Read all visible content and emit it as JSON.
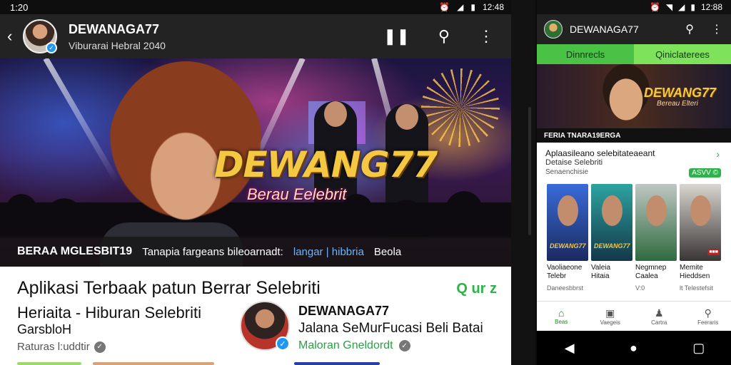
{
  "left": {
    "status": {
      "time": "1:20",
      "clock": "12:48"
    },
    "appbar": {
      "back": "‹",
      "channel_name": "DEWANAGA77",
      "channel_sub": "Viburarai Hebral 2040"
    },
    "banner": {
      "brand": "DEWANG77",
      "brand_sub": "Berau Eelebrit",
      "caption_bold": "BERAA MGLESBIT19",
      "caption_text": "Tanapia fargeans bileoarnadt:",
      "caption_link": "langar | hibbria",
      "caption_tail": "Beola"
    },
    "info": {
      "title": "Aplikasi Terbaak patun Berrar Selebriti",
      "badge": "Q ur z",
      "subtitle": "Heriaita - Hiburan Selebriti",
      "subtitle2": "GarsbloH",
      "meta": "Raturas l:uddtir",
      "author": "DEWANAGA77",
      "author_desc": "Jalana SeMurFucasi Beli Batai",
      "author_meta": "Maloran Gneldordt"
    }
  },
  "right": {
    "status": {
      "clock": "12:88"
    },
    "appbar": {
      "channel_name": "DEWANAGA77"
    },
    "tabs": [
      "Dinnrecls",
      "Qiniclaterees"
    ],
    "banner": {
      "brand": "DEWANG77",
      "brand_sub": "Bereau Elteri"
    },
    "caption": "FERIA TNARA19ERGA",
    "section": {
      "title": "Aplaasileano selebitateaeant",
      "sub": "Detaise Selebriti",
      "sub2": "Senaenchisie",
      "badge": "ASVV ©"
    },
    "thumbs": [
      {
        "tag": "DEWANG77",
        "title": "Vaoliaeone",
        "title2": "Telebr",
        "meta": "Daneesbbrst"
      },
      {
        "tag": "DEWANG77",
        "title": "Valeia",
        "title2": "Hitaia",
        "meta": ""
      },
      {
        "tag": "",
        "title": "Negmnep",
        "title2": "Caalea",
        "meta": "V:0"
      },
      {
        "tag": "",
        "title": "Memite",
        "title2": "Hieddsen",
        "meta": "lt Telestefsit"
      }
    ],
    "nav": [
      "Beas",
      "Vaegeis",
      "Cartra",
      "Feeraris"
    ]
  }
}
